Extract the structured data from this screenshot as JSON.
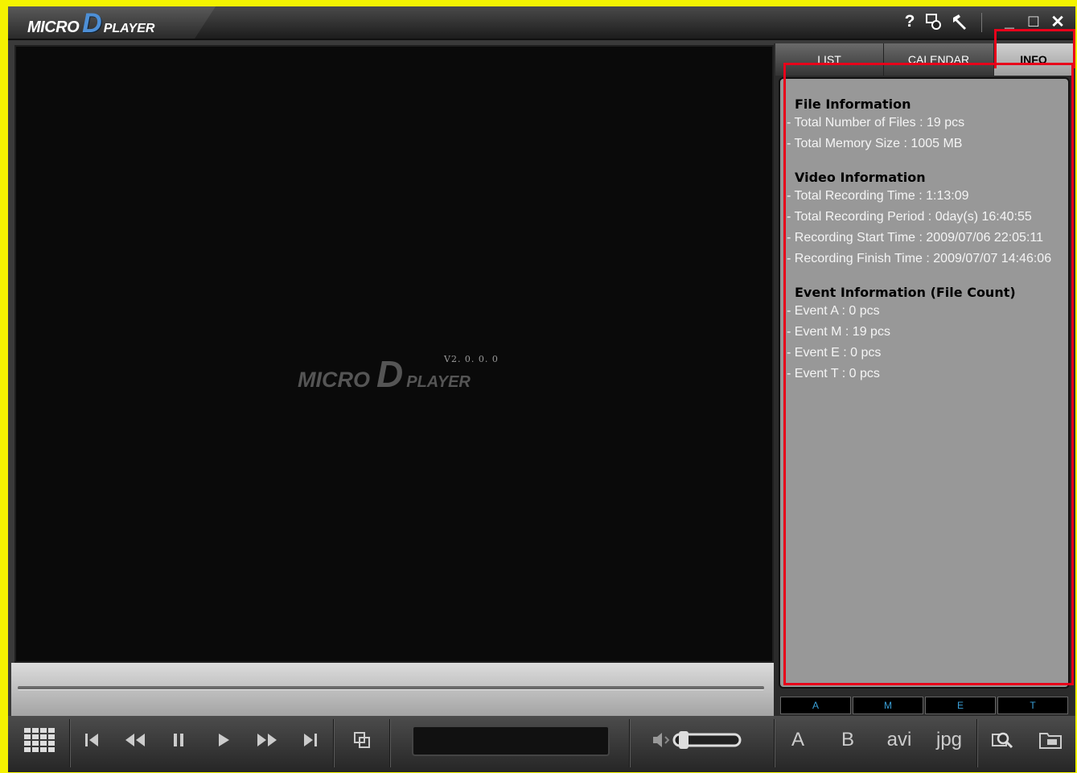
{
  "app": {
    "logo_micro": "MICRO",
    "logo_d": "D",
    "logo_player": "PLAYER",
    "version": "V2. 0. 0. 0"
  },
  "titlebar": {
    "help_icon": "?",
    "minimize_icon": "_",
    "maximize_icon": "□",
    "close_icon": "✕"
  },
  "tabs": [
    {
      "label": "LIST"
    },
    {
      "label": "CALENDAR"
    },
    {
      "label": "INFO"
    }
  ],
  "info": {
    "file_title": "File Information",
    "file_lines": [
      "- Total Number of Files : 19 pcs",
      "- Total Memory Size : 1005 MB"
    ],
    "video_title": "Video Information",
    "video_lines": [
      "- Total Recording Time : 1:13:09",
      "- Total Recording Period : 0day(s) 16:40:55",
      "- Recording Start Time : 2009/07/06 22:05:11",
      "- Recording Finish Time : 2009/07/07 14:46:06"
    ],
    "event_title": "Event Information (File Count)",
    "event_lines": [
      "- Event A : 0 pcs",
      "- Event M : 19 pcs",
      "- Event E : 0 pcs",
      "- Event T : 0 pcs"
    ]
  },
  "event_strip": [
    "A",
    "M",
    "E",
    "T"
  ],
  "toolbar": {
    "icons": [
      "grid-icon",
      "skip-start-icon",
      "rewind-icon",
      "pause-icon",
      "play-icon",
      "fast-forward-icon",
      "skip-end-icon",
      "screen-copy-icon",
      "volume-icon",
      "search-icon",
      "folder-icon"
    ],
    "btn_a": "A",
    "btn_b": "B",
    "btn_avi": "avi",
    "btn_jpg": "jpg"
  },
  "colors": {
    "highlight": "#e8001a",
    "accent": "#4d8fd6"
  }
}
